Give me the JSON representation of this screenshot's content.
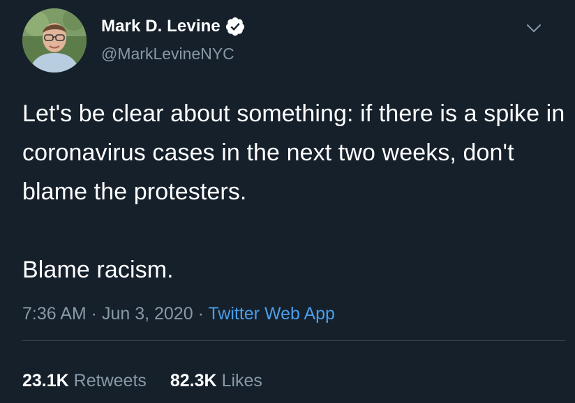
{
  "author": {
    "display_name": "Mark D. Levine",
    "handle": "@MarkLevineNYC",
    "verified": true
  },
  "icons": {
    "verified": "verified-badge-icon",
    "more": "chevron-down-icon"
  },
  "tweet": {
    "paragraphs": [
      "Let's be clear about something: if there is a spike in coronavirus cases in the next two weeks, don't blame the protesters.",
      "Blame racism."
    ]
  },
  "meta": {
    "time": "7:36 AM",
    "separator1": " · ",
    "date": "Jun 3, 2020",
    "separator2": " · ",
    "source": "Twitter Web App"
  },
  "stats": {
    "retweets_count": "23.1K",
    "retweets_label": "Retweets",
    "likes_count": "82.3K",
    "likes_label": "Likes"
  },
  "colors": {
    "background": "#15202b",
    "text_primary": "#ffffff",
    "text_secondary": "#8899a6",
    "link": "#4a9ee8",
    "divider": "#38444d"
  }
}
